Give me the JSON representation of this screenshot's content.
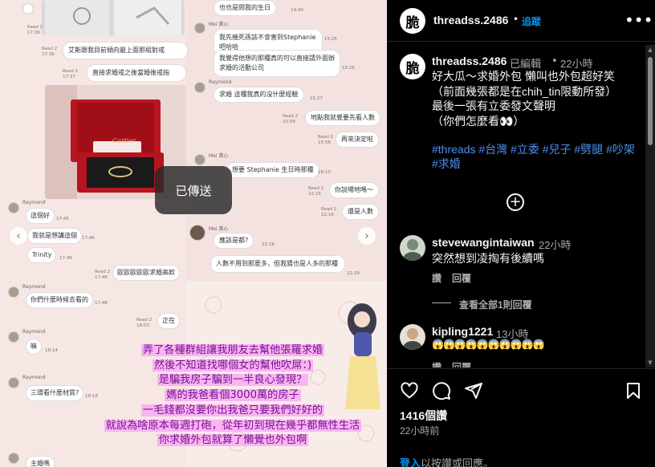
{
  "post_image": {
    "chat": {
      "read2_1736": "Read 2\n17:36",
      "msg_1": "艾斯跟我目前傾向最上面那組對戒",
      "read2_1737": "Read 2\n17:37",
      "msg_2": "直接求婚戒之後當婚後戒指",
      "sender_mei": "Mei 黃心",
      "right_top_1": "也也是問我的生日",
      "time_1440": "14:40",
      "right_2": "我先幾死孫該不會害到Stephanie吧哈哈",
      "time_1525": "15:25",
      "right_3": "我覺得他想的那種真的可以直接請外面辦求婚的活動公司",
      "time_1526": "15:26",
      "sender_raymond": "Raymond",
      "right_4": "求婚 這種我真的沒什麼經驗",
      "time_1527": "15:27",
      "right_5": "地點我就覺要先看人數",
      "right_6": "再來決定啦",
      "right_7": "想要 Stephanie 生日時那種",
      "time_1610": "16:10",
      "right_8": "你說場地嗎～",
      "right_9": "還是人數",
      "right_10": "應該是都?",
      "time_2228": "22:28",
      "right_11": "人數不用到那麼多，但我猜也是人多的那種",
      "time_2229": "22:29",
      "left_1": "這個好",
      "left_2": "我就是想講這個",
      "left_3": "Trinity",
      "left_4": "歐歐歐歐歐求婚高欸",
      "left_5": "你們什麼時候去看的",
      "left_6": "正在",
      "left_7": "嘛",
      "left_8": "三環看什麼材質?",
      "left_9": "主婚嗎"
    },
    "sent_toast": "已傳送",
    "overlay_lines": [
      "弄了各種群組讓我朋友去幫他張羅求婚",
      "然後不知道找哪個女的幫他吹屌：)",
      "是騙我房子騙到一半良心發現？",
      "媽的我爸看個3000萬的房子",
      "一毛錢都沒要你出我爸只要我們好好的",
      "就說為啥原本每週打砲，從年初到現在幾乎都無性生活",
      "你求婚外包就算了懶覺也外包啊"
    ]
  },
  "header": {
    "avatar_char": "脆",
    "username": "threadss.2486",
    "separator": "•",
    "follow_label": "追蹤",
    "more_icon": "•••"
  },
  "caption": {
    "avatar_char": "脆",
    "username": "threadss.2486",
    "edited": "已編輯",
    "dot": "•",
    "time": "22小時",
    "body": "好大瓜～求婚外包 懶叫也外包超好笑\n（前面幾張都是在chih_tin限動所發）\n最後一張有立委發文聲明\n（你們怎麼看👀）",
    "tags": "#threads #台灣 #立委 #兒子 #劈腿 #吵架 #求婚"
  },
  "comments": [
    {
      "username": "stevewangintaiwan",
      "time": "22小時",
      "text": "突然想到凌掏有後續嗎",
      "reply_label": "讚",
      "reply2_label": "回覆",
      "view_replies": "查看全部1則回覆"
    },
    {
      "username": "kipling1221",
      "time": "13小時",
      "text": "😱😱😱😱😱😱😱😱😱😱",
      "reply_label": "讚",
      "reply2_label": "回覆"
    }
  ],
  "footer": {
    "likes": "1416個讚",
    "post_time": "22小時前",
    "login_link": "登入",
    "login_rest": "以按讚或回應。"
  },
  "colors": {
    "accent_blue": "#0095f6",
    "hashtag_blue": "#4d8ef0",
    "overlay_text": "#7a0f93",
    "overlay_highlight": "#f7b0f2"
  }
}
